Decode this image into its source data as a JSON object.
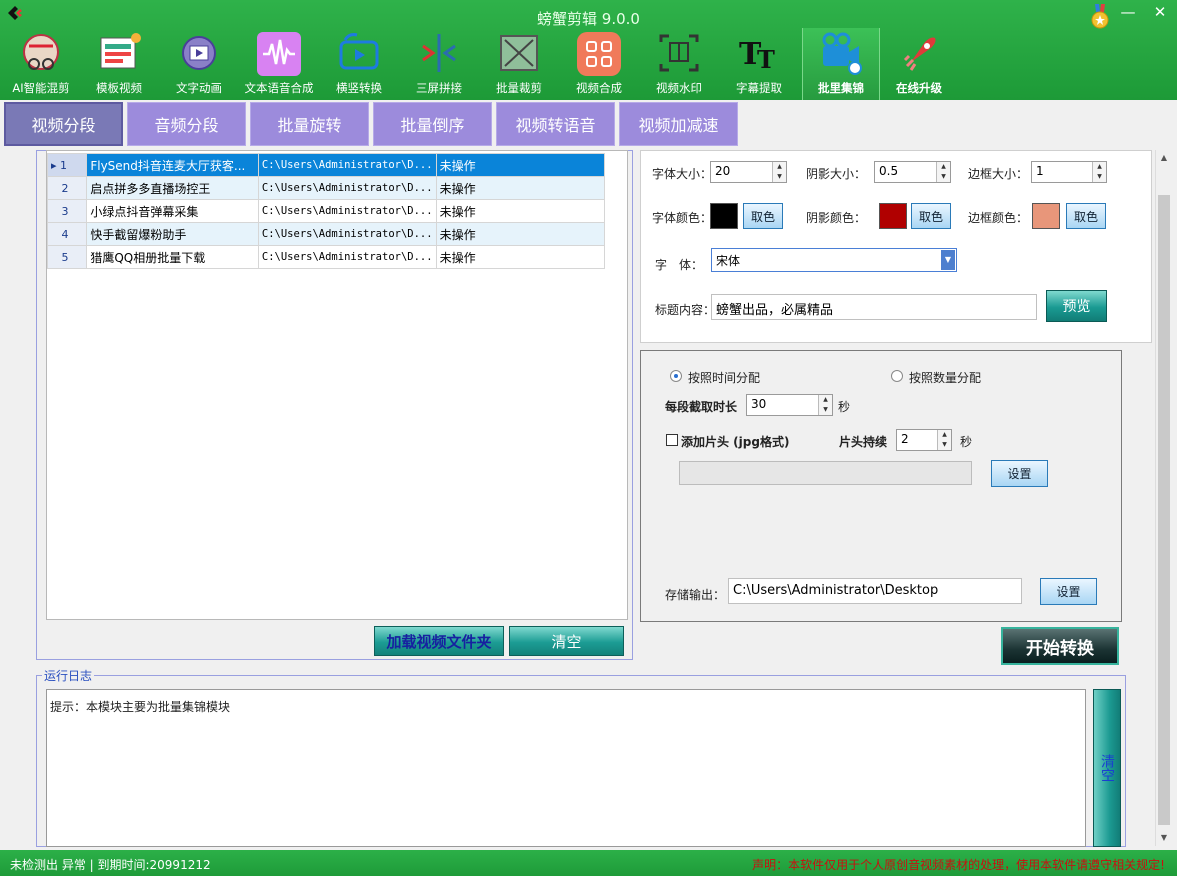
{
  "app": {
    "title": "螃蟹剪辑 9.0.0"
  },
  "window_controls": {
    "minimize": "—",
    "close": "✕"
  },
  "toolbar": [
    {
      "label": "AI智能混剪",
      "icon": "ai-mix-icon"
    },
    {
      "label": "模板视频",
      "icon": "template-video-icon"
    },
    {
      "label": "文字动画",
      "icon": "text-animation-icon"
    },
    {
      "label": "文本语音合成",
      "icon": "text-to-speech-icon"
    },
    {
      "label": "横竖转换",
      "icon": "orientation-convert-icon"
    },
    {
      "label": "三屏拼接",
      "icon": "three-screen-icon"
    },
    {
      "label": "批量裁剪",
      "icon": "batch-crop-icon"
    },
    {
      "label": "视频合成",
      "icon": "video-compose-icon"
    },
    {
      "label": "视频水印",
      "icon": "video-watermark-icon"
    },
    {
      "label": "字幕提取",
      "icon": "subtitle-extract-icon"
    },
    {
      "label": "批里集锦",
      "icon": "batch-highlights-icon"
    },
    {
      "label": "在线升级",
      "icon": "online-upgrade-icon"
    }
  ],
  "tabs": [
    "视频分段",
    "音频分段",
    "批量旋转",
    "批量倒序",
    "视频转语音",
    "视频加减速"
  ],
  "file_list": {
    "rows": [
      {
        "num": "1",
        "name": "FlySend抖音连麦大厅获客...",
        "path": "C:\\Users\\Administrator\\D...",
        "status": "未操作"
      },
      {
        "num": "2",
        "name": "启点拼多多直播场控王",
        "path": "C:\\Users\\Administrator\\D...",
        "status": "未操作"
      },
      {
        "num": "3",
        "name": "小绿点抖音弹幕采集",
        "path": "C:\\Users\\Administrator\\D...",
        "status": "未操作"
      },
      {
        "num": "4",
        "name": "快手截留爆粉助手",
        "path": "C:\\Users\\Administrator\\D...",
        "status": "未操作"
      },
      {
        "num": "5",
        "name": "猎鹰QQ相册批量下载",
        "path": "C:\\Users\\Administrator\\D...",
        "status": "未操作"
      }
    ],
    "load_button": "加载视频文件夹",
    "clear_button": "清空"
  },
  "font_settings": {
    "font_size_label": "字体大小：",
    "font_size": "20",
    "shadow_size_label": "阴影大小：",
    "shadow_size": "0.5",
    "border_size_label": "边框大小：",
    "border_size": "1",
    "font_color_label": "字体颜色：",
    "font_color": "#000000",
    "shadow_color_label": "阴影颜色：",
    "shadow_color": "#b00000",
    "border_color_label": "边框颜色：",
    "border_color": "#e8967a",
    "pick_color": "取色",
    "font_label": "字　体：",
    "font_value": "宋体",
    "title_label": "标题内容：",
    "title_value": "螃蟹出品，必属精品",
    "preview_button": "预览"
  },
  "segment_settings": {
    "by_time": "按照时间分配",
    "by_count": "按照数量分配",
    "segment_length_label": "每段截取时长",
    "segment_length": "30",
    "seconds": "秒",
    "add_intro_label": "添加片头 (jpg格式)",
    "intro_duration_label": "片头持续",
    "intro_duration": "2",
    "set_button": "设置",
    "output_label": "存储输出：",
    "output_path": "C:\\Users\\Administrator\\Desktop"
  },
  "start_button": "开始转换",
  "log": {
    "legend": "运行日志",
    "text": "提示：本模块主要为批量集锦模块",
    "clear_button": "清空"
  },
  "statusbar": {
    "left": "未检测出 异常 | 到期时间:20991212",
    "right": "声明：本软件仅用于个人原创音视频素材的处理，使用本软件请遵守相关规定!"
  }
}
